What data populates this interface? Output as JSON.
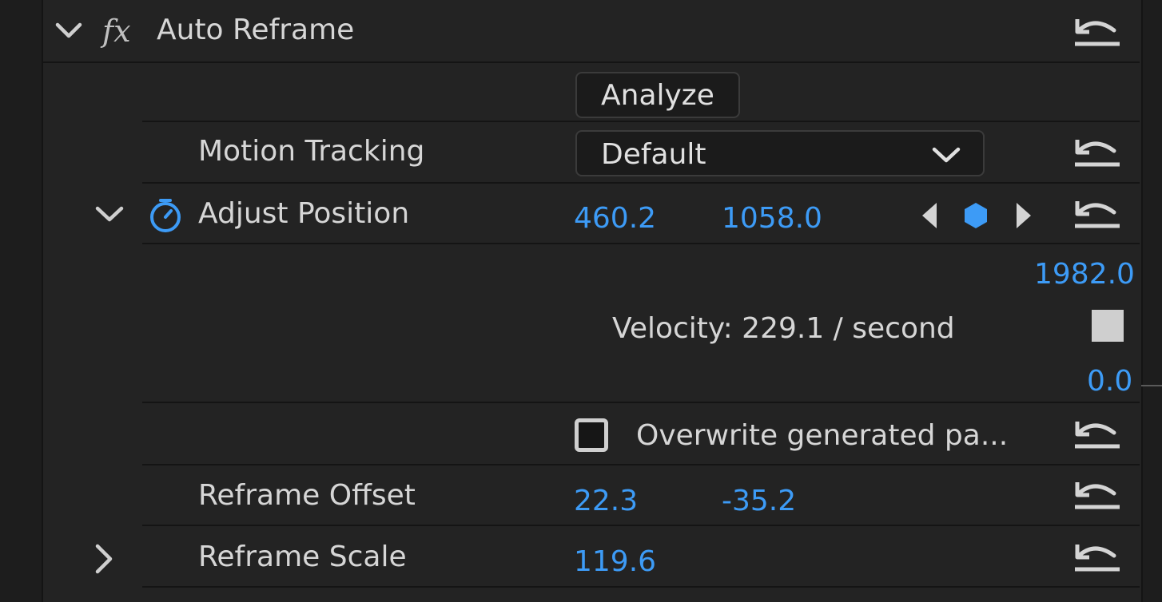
{
  "effect": {
    "title": "Auto Reframe",
    "fx_icon": "fx-icon"
  },
  "analyze": {
    "label": "Analyze"
  },
  "motion_tracking": {
    "label": "Motion Tracking",
    "value": "Default"
  },
  "adjust_position": {
    "label": "Adjust Position",
    "x": "460.2",
    "y": "1058.0",
    "range_max": "1982.0",
    "range_min": "0.0",
    "velocity": "Velocity: 229.1 / second"
  },
  "overwrite": {
    "label": "Overwrite generated pa...",
    "checked": false
  },
  "reframe_offset": {
    "label": "Reframe Offset",
    "x": "22.3",
    "y": "-35.2"
  },
  "reframe_scale": {
    "label": "Reframe Scale",
    "value": "119.6"
  },
  "colors": {
    "accent": "#3d9bf6",
    "text": "#d6d6d6",
    "panel": "#232323",
    "divider": "#141414"
  }
}
